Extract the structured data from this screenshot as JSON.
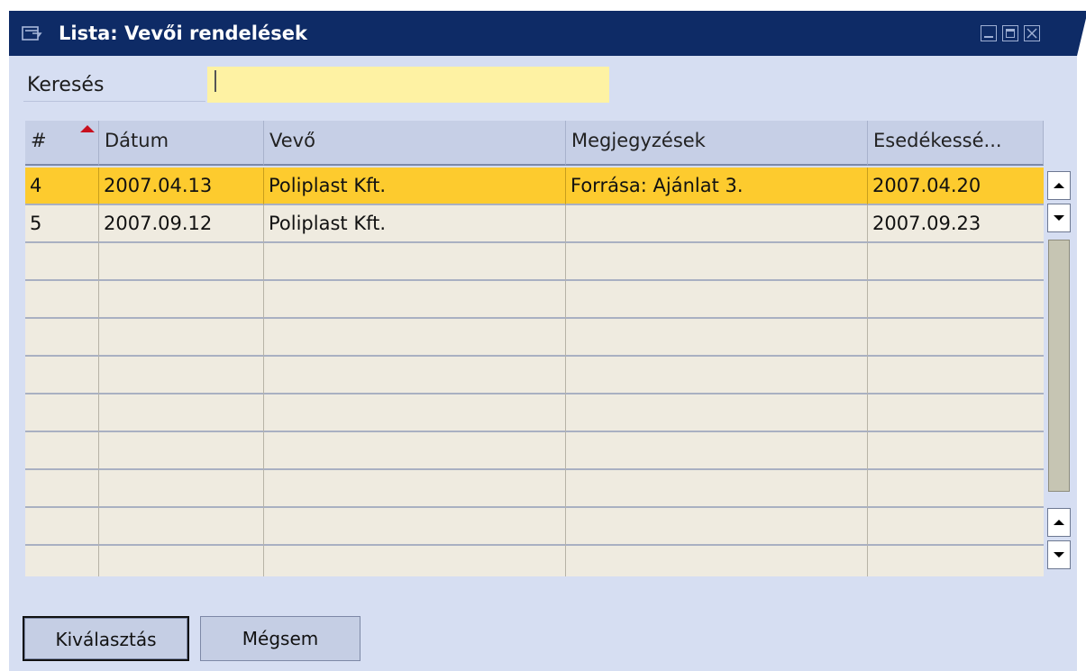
{
  "window": {
    "title": "Lista: Vevői rendelések",
    "icon": "list-window-icon",
    "controls": [
      "minimize-icon",
      "maximize-icon",
      "close-icon"
    ]
  },
  "search": {
    "label": "Keresés",
    "value": ""
  },
  "table": {
    "columns": [
      "#",
      "Dátum",
      "Vevő",
      "Megjegyzések",
      "Esedékessé..."
    ],
    "sorted_column": "#",
    "rows": [
      {
        "num": "4",
        "date": "2007.04.13",
        "customer": "Poliplast Kft.",
        "notes": "Forrása: Ajánlat 3.",
        "due": "2007.04.20",
        "selected": true
      },
      {
        "num": "5",
        "date": "2007.09.12",
        "customer": "Poliplast Kft.",
        "notes": "",
        "due": "2007.09.23",
        "selected": false
      }
    ]
  },
  "buttons": {
    "select": "Kiválasztás",
    "cancel": "Mégsem"
  },
  "colors": {
    "titlebar": "#0e2b66",
    "window_bg": "#d6def2",
    "search_bg": "#fef2a3",
    "selected_row": "#fdcb2e",
    "row_bg": "#efebe0",
    "sort_indicator": "#c8101e"
  }
}
